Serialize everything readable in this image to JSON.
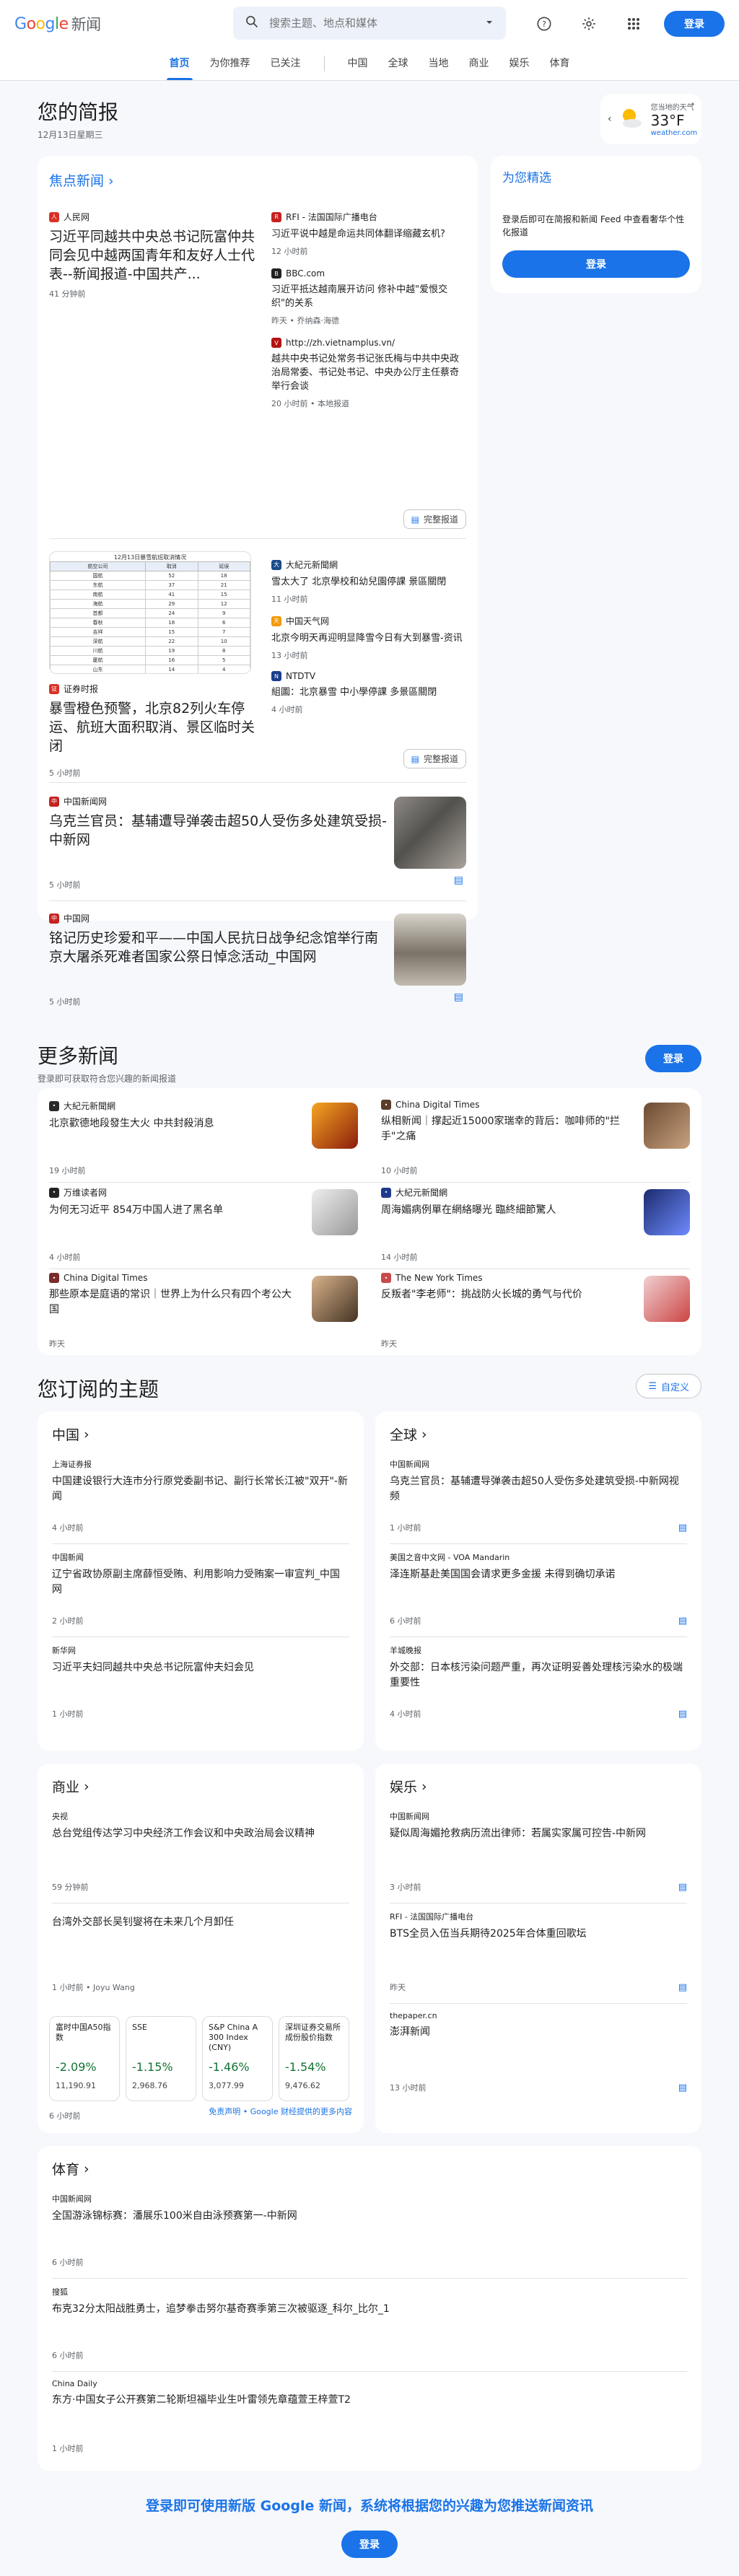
{
  "header": {
    "logo_google": "Google",
    "logo_news": "新闻",
    "search_placeholder": "搜索主题、地点和媒体",
    "login": "登录"
  },
  "nav": {
    "tabs": [
      "首页",
      "为你推荐",
      "已关注",
      "中国",
      "全球",
      "当地",
      "商业",
      "娱乐",
      "体育"
    ]
  },
  "briefing": {
    "title": "您的简报",
    "date": "12月13日星期三"
  },
  "weather": {
    "label": "您当地的天气",
    "temp": "33°F",
    "source": "weather.com"
  },
  "top": {
    "title": "焦点新闻",
    "cluster1": {
      "main": {
        "source": "人民网",
        "title": "习近平同越共中央总书记阮富仲共同会见中越两国青年和友好人士代表--新闻报道-中国共产...",
        "time": "41 分钟前"
      },
      "side": [
        {
          "source": "RFI - 法国国际广播电台",
          "title": "习近平说中越是命运共同体翻译缩藏玄机?",
          "time": "12 小时前"
        },
        {
          "source": "BBC.com",
          "title": "习近平抵达越南展开访问 修补中越\"爱恨交织\"的关系",
          "time": "昨天 • 乔纳森·海德"
        },
        {
          "source": "http://zh.vietnamplus.vn/",
          "title": "越共中央书记处常务书记张氏梅与中共中央政治局常委、书记处书记、中央办公厅主任蔡奇举行会谈",
          "time": "20 小时前 • 本地报道"
        }
      ],
      "full": "完整报道"
    },
    "cluster2": {
      "main": {
        "source": "证券时报",
        "title": "暴雪橙色预警，北京82列火车停运、航班大面积取消、景区临时关闭",
        "time": "5 小时前"
      },
      "side": [
        {
          "source": "大紀元新聞網",
          "title": "雪太大了 北京學校和幼兒園停課 景區關閉",
          "time": "11 小时前"
        },
        {
          "source": "中国天气网",
          "title": "北京今明天再迎明显降雪今日有大到暴雪-资讯",
          "time": "13 小时前"
        },
        {
          "source": "NTDTV",
          "title": "組圖：北京暴雪 中小學停課 多景區關閉",
          "time": "4 小时前"
        }
      ],
      "full": "完整报道",
      "table": {
        "caption": "12月13日暴雪航班取消情况",
        "headers": [
          "航空公司",
          "取消",
          "延误"
        ],
        "rows": [
          [
            "国航",
            "52",
            "18"
          ],
          [
            "东航",
            "37",
            "21"
          ],
          [
            "南航",
            "41",
            "15"
          ],
          [
            "海航",
            "29",
            "12"
          ],
          [
            "首都",
            "24",
            "9"
          ],
          [
            "春秋",
            "18",
            "6"
          ],
          [
            "吉祥",
            "15",
            "7"
          ],
          [
            "深航",
            "22",
            "10"
          ],
          [
            "川航",
            "19",
            "8"
          ],
          [
            "厦航",
            "16",
            "5"
          ],
          [
            "山东",
            "14",
            "4"
          ],
          [
            "祥鹏",
            "11",
            "3"
          ]
        ]
      }
    },
    "single": [
      {
        "source": "中国新闻网",
        "title": "乌克兰官员：基辅遭导弹袭击超50人受伤多处建筑受损-中新网",
        "time": "5 小时前"
      },
      {
        "source": "中国网",
        "title": "铭记历史珍爱和平——中国人民抗日战争纪念馆举行南京大屠杀死难者国家公祭日悼念活动_中国网",
        "time": "5 小时前"
      }
    ]
  },
  "picks": {
    "title": "为您精选",
    "desc": "登录后即可在简报和新闻 Feed 中查看奢华个性化报道",
    "login": "登录"
  },
  "more": {
    "title": "更多新闻",
    "sub": "登录即可获取符合您兴趣的新闻报道",
    "login": "登录",
    "items": [
      {
        "source": "大紀元新聞網",
        "title": "北京歡德地段發生大火 中共封殺消息",
        "time": "19 小时前"
      },
      {
        "source": "China Digital Times",
        "title": "纵相新闻｜撑起近15000家瑞幸的背后：咖啡师的\"拦手\"之痛",
        "time": "10 小时前"
      },
      {
        "source": "万维读者网",
        "title": "为何无习近平 854万中国人进了黑名单",
        "time": "4 小时前"
      },
      {
        "source": "大紀元新聞網",
        "title": "周海媚病例單在網絡曝光 臨終細節驚人",
        "time": "14 小时前"
      },
      {
        "source": "China Digital Times",
        "title": "那些原本是庭语的常识｜世界上为什么只有四个考公大国",
        "time": "昨天"
      },
      {
        "source": "The New York Times",
        "title": "反叛者\"李老师\"：挑战防火长城的勇气与代价",
        "time": "昨天"
      }
    ]
  },
  "topics": {
    "title": "您订阅的主题",
    "customize": "自定义",
    "china": {
      "title": "中国",
      "items": [
        {
          "source": "上海证券报",
          "title": "中国建设银行大连市分行原党委副书记、副行长常长江被\"双开\"-新闻",
          "time": "4 小时前"
        },
        {
          "source": "中国新闻",
          "title": "辽宁省政协原副主席薛恒受贿、利用影响力受贿案一审宣判_中国网",
          "time": "2 小时前"
        },
        {
          "source": "新华网",
          "title": "习近平夫妇同越共中央总书记阮富仲夫妇会见",
          "time": "1 小时前"
        }
      ]
    },
    "world": {
      "title": "全球",
      "items": [
        {
          "source": "中国新闻网",
          "title": "乌克兰官员：基辅遭导弹袭击超50人受伤多处建筑受损-中新网视频",
          "time": "1 小时前"
        },
        {
          "source": "美国之音中文网 - VOA Mandarin",
          "title": "泽连斯基赴美国国会请求更多金援 未得到确切承诺",
          "time": "6 小时前"
        },
        {
          "source": "羊城晚报",
          "title": "外交部：日本核污染问题严重，再次证明妥善处理核污染水的极端重要性",
          "time": "4 小时前"
        }
      ]
    },
    "business": {
      "title": "商业",
      "items": [
        {
          "source": "央视",
          "title": "总台党组传达学习中央经济工作会议和中央政治局会议精神",
          "time": "59 分钟前"
        },
        {
          "source": "",
          "title": "台湾外交部长吴钊燮将在未来几个月卸任",
          "time": "1 小时前 • Joyu Wang"
        }
      ],
      "stocks": [
        {
          "name": "富时中国A50指数",
          "change": "-2.09%",
          "value": "11,190.91"
        },
        {
          "name": "SSE",
          "change": "-1.15%",
          "value": "2,968.76"
        },
        {
          "name": "S&P China A 300 Index (CNY)",
          "change": "-1.46%",
          "value": "3,077.99"
        },
        {
          "name": "深圳证券交易所成份股价指数",
          "change": "-1.54%",
          "value": "9,476.62"
        }
      ],
      "time": "6 小时前",
      "disclaimer": "免责声明 • Google 财经提供的更多内容"
    },
    "ent": {
      "title": "娱乐",
      "items": [
        {
          "source": "中国新闻网",
          "title": "疑似周海媚抢救病历流出律师：若属实家属可控告-中新网",
          "time": "3 小时前"
        },
        {
          "source": "RFI - 法国国际广播电台",
          "title": "BTS全员入伍当兵期待2025年合体重回歌坛",
          "time": "昨天"
        },
        {
          "source": "thepaper.cn",
          "title": "澎湃新闻",
          "time": "13 小时前"
        }
      ]
    },
    "sports": {
      "title": "体育",
      "items": [
        {
          "source": "中国新闻网",
          "title": "全国游泳锦标赛：潘展乐100米自由泳预赛第一-中新网",
          "time": "6 小时前"
        },
        {
          "source": "搜狐",
          "title": "布克32分太阳战胜勇士，追梦拳击努尔基奇赛季第三次被驱逐_科尔_比尔_1",
          "time": "6 小时前"
        },
        {
          "source": "China Daily",
          "title": "东方·中国女子公开赛第二轮斯坦福毕业生叶雷领先章蕴萱王梓萱T2",
          "time": "1 小时前"
        }
      ]
    }
  },
  "footer": {
    "text": "登录即可使用新版 Google 新闻，系统将根据您的兴趣为您推送新闻资讯",
    "login": "登录"
  },
  "colors": {
    "accent": "#1a73e8",
    "neg": "#c5221f"
  }
}
